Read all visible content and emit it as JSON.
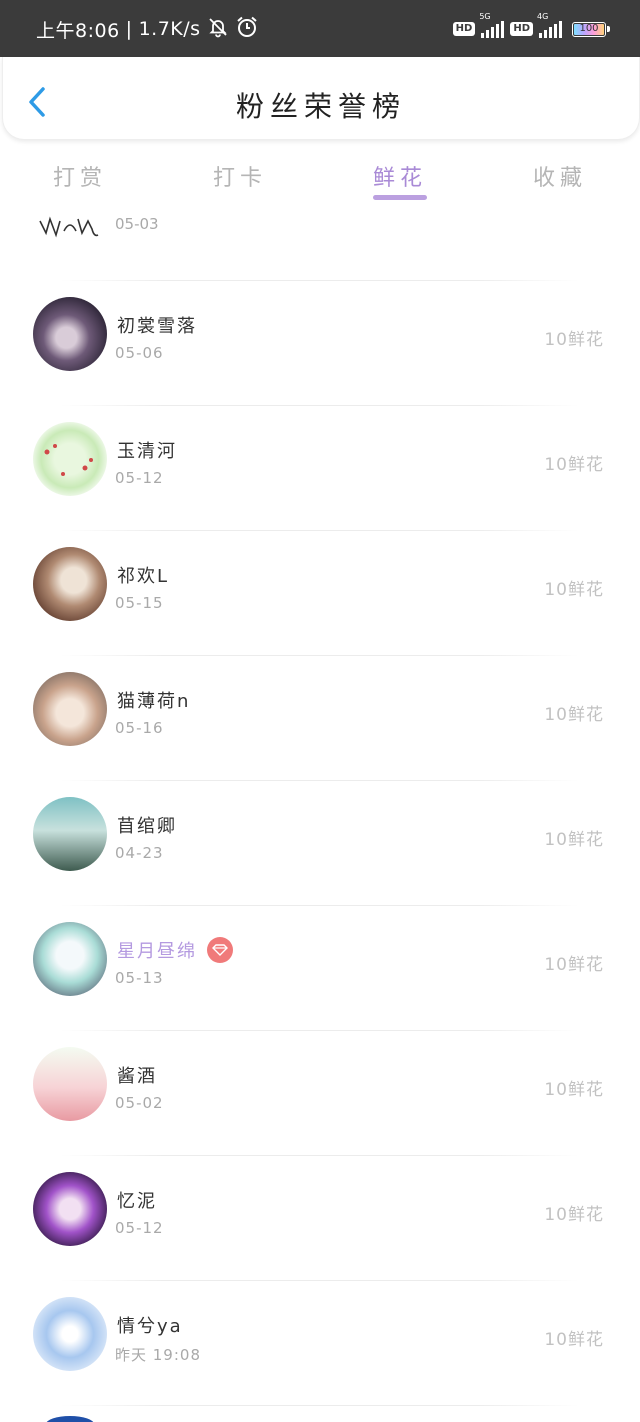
{
  "status_bar": {
    "time": "上午8:06",
    "speed": "1.7K/s",
    "network_1": "5G",
    "network_2": "4G",
    "hd": "HD",
    "battery": "100"
  },
  "header": {
    "title": "粉丝荣誉榜"
  },
  "tabs": [
    {
      "label": "打赏",
      "active": false
    },
    {
      "label": "打卡",
      "active": false
    },
    {
      "label": "鲜花",
      "active": true
    },
    {
      "label": "收藏",
      "active": false
    }
  ],
  "partial_row": {
    "date": "05-03"
  },
  "rows": [
    {
      "name": "初裳雪落",
      "date": "05-06",
      "amount": "10鲜花",
      "vip": false
    },
    {
      "name": "玉清河",
      "date": "05-12",
      "amount": "10鲜花",
      "vip": false
    },
    {
      "name": "祁欢L",
      "date": "05-15",
      "amount": "10鲜花",
      "vip": false
    },
    {
      "name": "猫薄荷n",
      "date": "05-16",
      "amount": "10鲜花",
      "vip": false
    },
    {
      "name": "苜绾卿",
      "date": "04-23",
      "amount": "10鲜花",
      "vip": false
    },
    {
      "name": "星月昼绵",
      "date": "05-13",
      "amount": "10鲜花",
      "vip": true
    },
    {
      "name": "酱酒",
      "date": "05-02",
      "amount": "10鲜花",
      "vip": false
    },
    {
      "name": "忆泥",
      "date": "05-12",
      "amount": "10鲜花",
      "vip": false
    },
    {
      "name": "情兮ya",
      "date": "昨天 19:08",
      "amount": "10鲜花",
      "vip": false
    }
  ],
  "colors": {
    "accent": "#a98ad6",
    "status_bar": "#3b3b3b",
    "back_arrow": "#2e9be6",
    "badge": "#f07a7a"
  }
}
